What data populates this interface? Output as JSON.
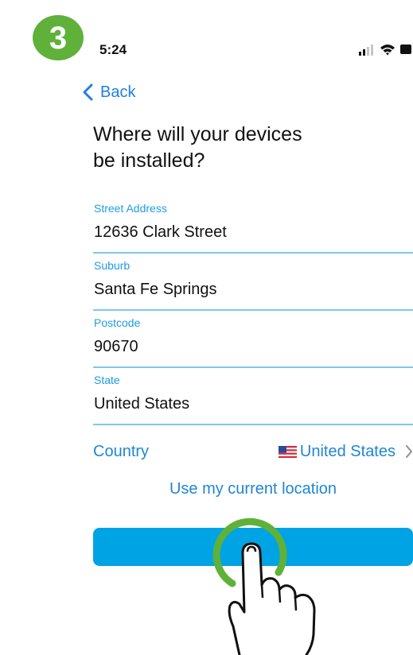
{
  "step": {
    "number": "3"
  },
  "status_bar": {
    "time": "5:24",
    "icons": [
      "cellular-signal-icon",
      "wifi-icon",
      "battery-icon"
    ]
  },
  "nav": {
    "back_label": "Back"
  },
  "title": {
    "line1": "Where will your devices",
    "line2": "be installed?"
  },
  "fields": [
    {
      "label": "Street Address",
      "value": "12636 Clark Street"
    },
    {
      "label": "Suburb",
      "value": "Santa Fe Springs"
    },
    {
      "label": "Postcode",
      "value": "90670"
    },
    {
      "label": "State",
      "value": "United States"
    }
  ],
  "country": {
    "label": "Country",
    "value": "United States",
    "flag_icon": "us-flag-icon"
  },
  "location_link": "Use my current location",
  "next_button": {
    "label": ""
  },
  "colors": {
    "accent": "#1e86d6",
    "field_label": "#1c9ee0",
    "field_underline": "#7fc7ee",
    "button": "#00a3e3",
    "step_badge": "#5fb139"
  }
}
